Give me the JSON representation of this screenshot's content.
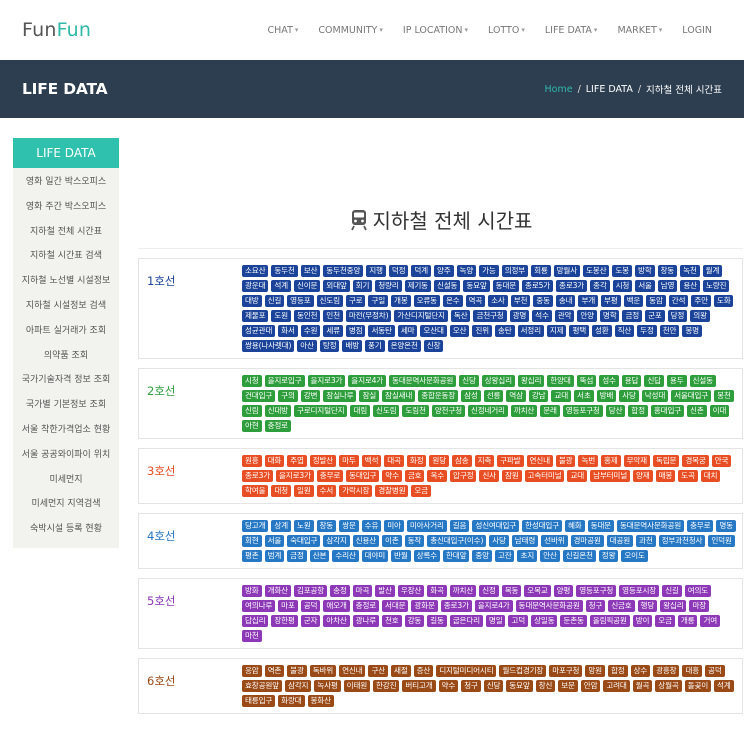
{
  "brand": {
    "part1": "Fun",
    "part2": "Fun"
  },
  "nav": [
    {
      "label": "CHAT",
      "dropdown": true
    },
    {
      "label": "COMMUNITY",
      "dropdown": true
    },
    {
      "label": "IP LOCATION",
      "dropdown": true
    },
    {
      "label": "LOTTO",
      "dropdown": true
    },
    {
      "label": "LIFE DATA",
      "dropdown": true
    },
    {
      "label": "MARKET",
      "dropdown": true
    },
    {
      "label": "LOGIN",
      "dropdown": false
    }
  ],
  "banner": {
    "title": "LIFE DATA",
    "crumb_home": "Home",
    "crumb_section": "LIFE DATA",
    "crumb_page": "지하철 전체 시간표"
  },
  "sidebar": {
    "header": "LIFE DATA",
    "items": [
      "영화 일간 박스오피스",
      "영화 주간 박스오피스",
      "지하철 전체 시간표",
      "지하철 시간표 검색",
      "지하철 노선별 시설정보",
      "지하철 시설정보 검색",
      "아파트 실거래가 조회",
      "의약품 조회",
      "국가기술자격 정보 조회",
      "국가별 기본정보 조회",
      "서울 착한가격업소 현황",
      "서울 공공와이파이 위치",
      "미세먼지",
      "미세먼지 지역검색",
      "숙박시설 등록 현황"
    ]
  },
  "page_title": "지하철 전체 시간표",
  "icons": {
    "title_icon": "subway-train-icon"
  },
  "colors": {
    "accent": "#2fc1ae",
    "banner": "#2d3e50",
    "line1": "#1a4399",
    "line2": "#2e9e3c",
    "line3": "#e84e23",
    "line4": "#2778c4",
    "line5": "#8d38b7",
    "line6": "#9a4a17"
  },
  "lines": [
    {
      "cls": "l1",
      "name": "1호선",
      "stations": [
        "소요산",
        "동두천",
        "보산",
        "동두천중앙",
        "지행",
        "덕정",
        "덕계",
        "양주",
        "녹양",
        "가능",
        "의정부",
        "회룡",
        "망월사",
        "도봉산",
        "도봉",
        "방학",
        "창동",
        "녹천",
        "월계",
        "광운대",
        "석계",
        "신이문",
        "외대앞",
        "회기",
        "청량리",
        "제기동",
        "신설동",
        "동묘앞",
        "동대문",
        "종로5가",
        "종로3가",
        "종각",
        "시청",
        "서울",
        "남영",
        "용산",
        "노량진",
        "대방",
        "신길",
        "영등포",
        "신도림",
        "구로",
        "구일",
        "개봉",
        "오류동",
        "온수",
        "역곡",
        "소사",
        "부천",
        "중동",
        "송내",
        "부개",
        "부평",
        "백운",
        "동암",
        "간석",
        "주안",
        "도화",
        "제물포",
        "도원",
        "동인천",
        "인천",
        "마전(무정차)",
        "가산디지털단지",
        "독산",
        "금천구청",
        "광명",
        "석수",
        "관악",
        "안양",
        "명학",
        "금정",
        "군포",
        "당정",
        "의왕",
        "성균관대",
        "화서",
        "수원",
        "세류",
        "병점",
        "서동탄",
        "세마",
        "오산대",
        "오산",
        "진위",
        "송탄",
        "서정리",
        "지제",
        "평택",
        "성환",
        "직산",
        "두정",
        "천안",
        "봉명",
        "쌍용(나사렛대)",
        "아산",
        "탕정",
        "배방",
        "풍기",
        "온양온천",
        "신창"
      ]
    },
    {
      "cls": "l2",
      "name": "2호선",
      "stations": [
        "시청",
        "을지로입구",
        "을지로3가",
        "을지로4가",
        "동대문역사문화공원",
        "신당",
        "상왕십리",
        "왕십리",
        "한양대",
        "뚝섬",
        "성수",
        "용답",
        "신답",
        "용두",
        "신설동",
        "건대입구",
        "구의",
        "강변",
        "잠실나루",
        "잠실",
        "잠실새내",
        "종합운동장",
        "삼성",
        "선릉",
        "역삼",
        "강남",
        "교대",
        "서초",
        "방배",
        "사당",
        "낙성대",
        "서울대입구",
        "봉천",
        "신림",
        "신대방",
        "구로디지털단지",
        "대림",
        "신도림",
        "도림천",
        "양천구청",
        "신정네거리",
        "까치산",
        "문래",
        "영등포구청",
        "당산",
        "합정",
        "홍대입구",
        "신촌",
        "이대",
        "아현",
        "충정로"
      ]
    },
    {
      "cls": "l3",
      "name": "3호선",
      "stations": [
        "원흥",
        "대화",
        "주엽",
        "정발산",
        "마두",
        "백석",
        "대곡",
        "화정",
        "원당",
        "삼송",
        "지축",
        "구파발",
        "연신내",
        "불광",
        "녹번",
        "홍제",
        "무악재",
        "독립문",
        "경복궁",
        "안국",
        "종로3가",
        "을지로3가",
        "충무로",
        "동대입구",
        "약수",
        "금호",
        "옥수",
        "압구정",
        "신사",
        "잠원",
        "고속터미널",
        "교대",
        "남부터미널",
        "양재",
        "매봉",
        "도곡",
        "대치",
        "학여울",
        "대청",
        "일원",
        "수서",
        "가락시장",
        "경찰병원",
        "오금"
      ]
    },
    {
      "cls": "l4",
      "name": "4호선",
      "stations": [
        "당고개",
        "상계",
        "노원",
        "창동",
        "쌍문",
        "수유",
        "미아",
        "미아사거리",
        "길음",
        "성신여대입구",
        "한성대입구",
        "혜화",
        "동대문",
        "동대문역사문화공원",
        "충무로",
        "명동",
        "회현",
        "서울",
        "숙대입구",
        "삼각지",
        "신용산",
        "이촌",
        "동작",
        "총신대입구(이수)",
        "사당",
        "남태령",
        "선바위",
        "경마공원",
        "대공원",
        "과천",
        "정부과천청사",
        "인덕원",
        "평촌",
        "범계",
        "금정",
        "산본",
        "수리산",
        "대야미",
        "반월",
        "상록수",
        "한대앞",
        "중앙",
        "고잔",
        "초지",
        "안산",
        "신길온천",
        "정왕",
        "오이도"
      ]
    },
    {
      "cls": "l5",
      "name": "5호선",
      "stations": [
        "방화",
        "개화산",
        "김포공항",
        "송정",
        "마곡",
        "발산",
        "우장산",
        "화곡",
        "까치산",
        "신정",
        "목동",
        "오목교",
        "양평",
        "영등포구청",
        "영등포시장",
        "신길",
        "여의도",
        "여의나루",
        "마포",
        "공덕",
        "애오개",
        "충정로",
        "서대문",
        "광화문",
        "종로3가",
        "을지로4가",
        "동대문역사문화공원",
        "청구",
        "신금호",
        "행당",
        "왕십리",
        "마장",
        "답십리",
        "장한평",
        "군자",
        "아차산",
        "광나루",
        "천호",
        "강동",
        "길동",
        "굽은다리",
        "명일",
        "고덕",
        "상일동",
        "둔촌동",
        "올림픽공원",
        "방이",
        "오금",
        "개롱",
        "거여",
        "마천"
      ]
    },
    {
      "cls": "l6",
      "name": "6호선",
      "stations": [
        "응암",
        "역촌",
        "불광",
        "독바위",
        "연신내",
        "구산",
        "새절",
        "증산",
        "디지털미디어시티",
        "월드컵경기장",
        "마포구청",
        "망원",
        "합정",
        "상수",
        "광흥창",
        "대흥",
        "공덕",
        "효창공원앞",
        "삼각지",
        "녹사평",
        "이태원",
        "한강진",
        "버티고개",
        "약수",
        "청구",
        "신당",
        "동묘앞",
        "창신",
        "보문",
        "안암",
        "고려대",
        "월곡",
        "상월곡",
        "돌곶이",
        "석계",
        "태릉입구",
        "화랑대",
        "봉화산"
      ]
    }
  ]
}
